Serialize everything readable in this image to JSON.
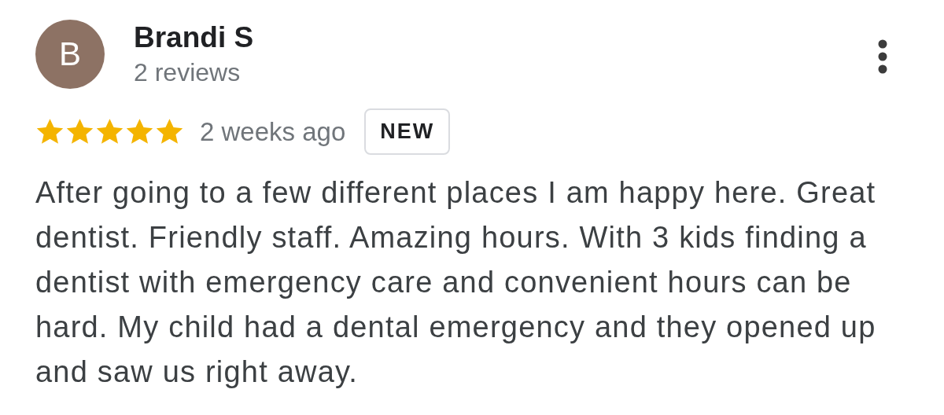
{
  "review": {
    "avatar_letter": "B",
    "author": "Brandi S",
    "author_meta": "2 reviews",
    "stars": 5,
    "time": "2 weeks ago",
    "badge": "NEW",
    "text": "After going to a few different places I am happy here. Great dentist. Friendly staff. Amazing hours. With 3 kids finding a dentist with emergency care and convenient hours can be hard. My child had a dental emergency and they opened up and saw us right away."
  }
}
